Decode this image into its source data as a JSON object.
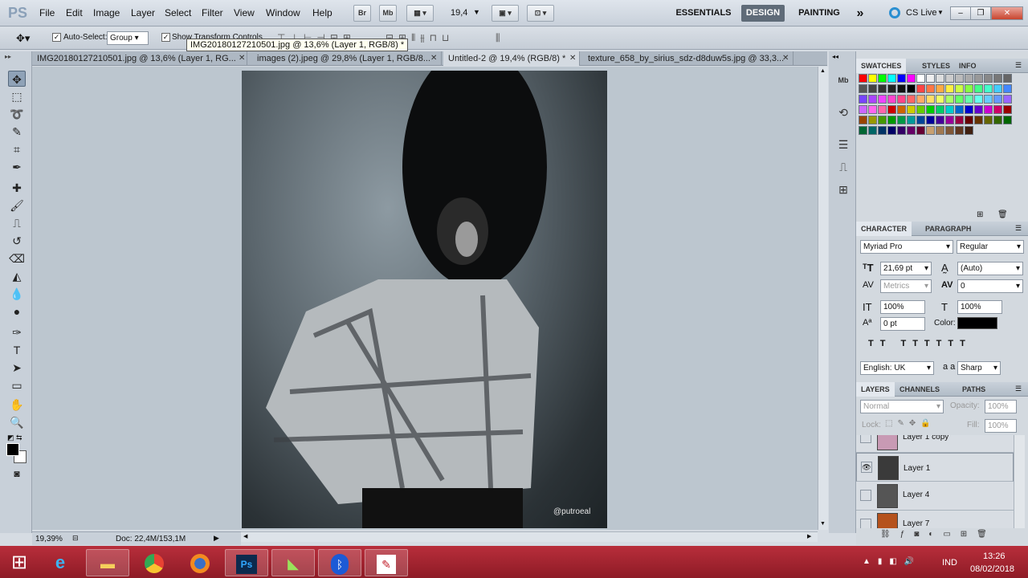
{
  "app": {
    "logo": "PS"
  },
  "menu": [
    "File",
    "Edit",
    "Image",
    "Layer",
    "Select",
    "Filter",
    "View",
    "Window",
    "Help"
  ],
  "menubar": {
    "zoom": "19,4",
    "br": "Br",
    "mb": "Mb"
  },
  "workspaces": {
    "essentials": "ESSENTIALS",
    "design": "DESIGN",
    "painting": "PAINTING",
    "more": "»",
    "cslive": "CS Live"
  },
  "options": {
    "auto_select_label": "Auto-Select:",
    "auto_select_value": "Group",
    "show_transform": "Show Transform Controls"
  },
  "tooltip": "IMG20180127210501.jpg @ 13,6% (Layer 1, RGB/8) *",
  "tabs": [
    {
      "label": "IMG20180127210501.jpg @ 13,6% (Layer 1, RG...",
      "close": "✕"
    },
    {
      "label": "images (2).jpeg @ 29,8% (Layer 1, RGB/8...",
      "close": "✕"
    },
    {
      "label": "Untitled-2 @ 19,4% (RGB/8) *",
      "close": "✕"
    },
    {
      "label": "texture_658_by_sirius_sdz-d8duw5s.jpg @ 33,3...",
      "close": "✕"
    }
  ],
  "status": {
    "zoom": "19,39%",
    "doc": "Doc: 22,4M/153,1M"
  },
  "watermark": "@putroeal",
  "panels": {
    "swatches_tabs": [
      "SWATCHES",
      "STYLES",
      "INFO"
    ],
    "character_tabs": [
      "CHARACTER",
      "PARAGRAPH"
    ],
    "font_family": "Myriad Pro",
    "font_style": "Regular",
    "font_size": "21,69 pt",
    "leading": "(Auto)",
    "kerning": "Metrics",
    "tracking": "0",
    "vscale": "100%",
    "hscale": "100%",
    "baseline": "0 pt",
    "color_label": "Color:",
    "language": "English: UK",
    "aa_label": "a a",
    "antialias": "Sharp",
    "layers_tabs": [
      "LAYERS",
      "CHANNELS",
      "PATHS"
    ],
    "blend_mode": "Normal",
    "opacity_label": "Opacity:",
    "opacity_value": "100%",
    "lock_label": "Lock:",
    "fill_label": "Fill:",
    "fill_value": "100%",
    "layers": [
      "Layer 1 copy",
      "Layer 1",
      "Layer 4",
      "Layer 7"
    ]
  },
  "taskbar": {
    "lang": "IND",
    "time": "13:26",
    "date": "08/02/2018"
  },
  "colors": {
    "taskbar": "#9e2330",
    "accent": "#5f6b78"
  }
}
